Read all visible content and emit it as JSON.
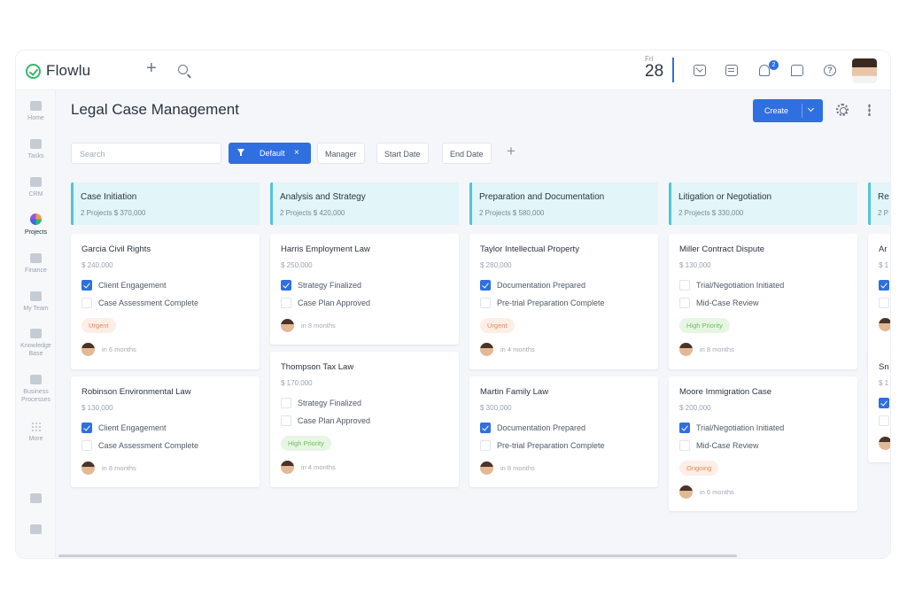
{
  "app": {
    "name": "Flowlu"
  },
  "topbar": {
    "day": "Fri",
    "date": "28",
    "notification_count": "2"
  },
  "sidebar": {
    "items": [
      {
        "label": "Home"
      },
      {
        "label": "Tasks"
      },
      {
        "label": "CRM"
      },
      {
        "label": "Projects"
      },
      {
        "label": "Finance"
      },
      {
        "label": "My Team"
      },
      {
        "label_1": "Knowledge",
        "label_2": "Base"
      },
      {
        "label_1": "Business",
        "label_2": "Processes"
      },
      {
        "label": "More"
      }
    ]
  },
  "page": {
    "title": "Legal Case Management",
    "create_label": "Create"
  },
  "filters": {
    "search_placeholder": "Search",
    "active_filter": "Default",
    "pills": [
      "Manager",
      "Start Date",
      "End Date"
    ]
  },
  "colors": {
    "accent": "#2f6fe0",
    "column_header": "#e2f5f8",
    "column_border": "#52c5d8",
    "logo": "#3ab56b"
  },
  "columns": [
    {
      "title": "Case Initiation",
      "meta": "2 Projects   $ 370,000",
      "cards": [
        {
          "title": "Garcia Civil Rights",
          "amount": "$ 240,000",
          "tasks": [
            {
              "label": "Client Engagement",
              "checked": true
            },
            {
              "label": "Case Assessment Complete",
              "checked": false
            }
          ],
          "tag": "Urgent",
          "due": "in 6 months"
        },
        {
          "title": "Robinson Environmental Law",
          "amount": "$ 130,000",
          "tasks": [
            {
              "label": "Client Engagement",
              "checked": true
            },
            {
              "label": "Case Assessment Complete",
              "checked": false
            }
          ],
          "tag": "",
          "due": "in 8 months"
        }
      ]
    },
    {
      "title": "Analysis and Strategy",
      "meta": "2 Projects   $ 420,000",
      "cards": [
        {
          "title": "Harris Employment Law",
          "amount": "$ 250,000",
          "tasks": [
            {
              "label": "Strategy Finalized",
              "checked": true
            },
            {
              "label": "Case Plan Approved",
              "checked": false
            }
          ],
          "tag": "",
          "due": "in 8 months"
        },
        {
          "title": "Thompson Tax Law",
          "amount": "$ 170,000",
          "tasks": [
            {
              "label": "Strategy Finalized",
              "checked": false
            },
            {
              "label": "Case Plan Approved",
              "checked": false
            }
          ],
          "tag": "High Priority",
          "due": "in 4 months"
        }
      ]
    },
    {
      "title": "Preparation and Documentation",
      "meta": "2 Projects   $ 580,000",
      "cards": [
        {
          "title": "Taylor Intellectual Property",
          "amount": "$ 280,000",
          "tasks": [
            {
              "label": "Documentation Prepared",
              "checked": true
            },
            {
              "label": "Pre-trial Preparation Complete",
              "checked": false
            }
          ],
          "tag": "Urgent",
          "due": "in 4 months"
        },
        {
          "title": "Martin Family Law",
          "amount": "$ 300,000",
          "tasks": [
            {
              "label": "Documentation Prepared",
              "checked": true
            },
            {
              "label": "Pre-trial Preparation Complete",
              "checked": false
            }
          ],
          "tag": "",
          "due": "in 8 months"
        }
      ]
    },
    {
      "title": "Litigation or Negotiation",
      "meta": "2 Projects   $ 330,000",
      "cards": [
        {
          "title": "Miller Contract Dispute",
          "amount": "$ 130,000",
          "tasks": [
            {
              "label": "Trial/Negotiation Initiated",
              "checked": false
            },
            {
              "label": "Mid-Case Review",
              "checked": false
            }
          ],
          "tag": "High Priority",
          "due": "in 8 months"
        },
        {
          "title": "Moore Immigration Case",
          "amount": "$ 200,000",
          "tasks": [
            {
              "label": "Trial/Negotiation Initiated",
              "checked": true
            },
            {
              "label": "Mid-Case Review",
              "checked": false
            }
          ],
          "tag": "Ongoing",
          "due": "in 6 months"
        }
      ]
    },
    {
      "title": "Re",
      "meta": "2 P",
      "cards": [
        {
          "title": "Ar",
          "amount": "$ 1"
        },
        {
          "title": "Sn",
          "amount": "$ 1"
        }
      ]
    }
  ]
}
